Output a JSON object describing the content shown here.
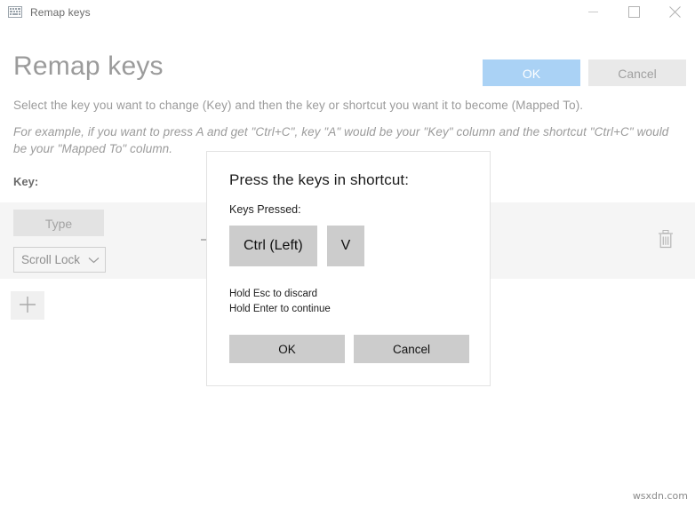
{
  "window": {
    "title": "Remap keys",
    "icon": "keyboard-icon",
    "controls": {
      "minimize": "minimize-icon",
      "maximize": "maximize-icon",
      "close": "close-icon"
    }
  },
  "header": {
    "page_title": "Remap keys",
    "ok_label": "OK",
    "cancel_label": "Cancel",
    "ok_color": "#aad2f5",
    "cancel_color": "#e9e9e9"
  },
  "description": {
    "line1": "Select the key you want to change (Key) and then the key or shortcut you want it to become (Mapped To).",
    "line2": "For example, if you want to press A and get \"Ctrl+C\", key \"A\" would be your \"Key\" column and the shortcut \"Ctrl+C\" would be your \"Mapped To\" column."
  },
  "table": {
    "key_column_header": "Key:",
    "rows": [
      {
        "type_button_label": "Type",
        "key_value": "Scroll Lock",
        "dropdown_icon": "chevron-down-icon",
        "delete_icon": "trash-icon"
      }
    ],
    "add_button_icon": "plus-icon"
  },
  "dialog": {
    "title": "Press the keys in shortcut:",
    "keys_pressed_label": "Keys Pressed:",
    "keys": [
      "Ctrl (Left)",
      "V"
    ],
    "hint1": "Hold Esc to discard",
    "hint2": "Hold Enter to continue",
    "ok_label": "OK",
    "cancel_label": "Cancel"
  },
  "watermark": {
    "text": "wsxdn.com"
  }
}
